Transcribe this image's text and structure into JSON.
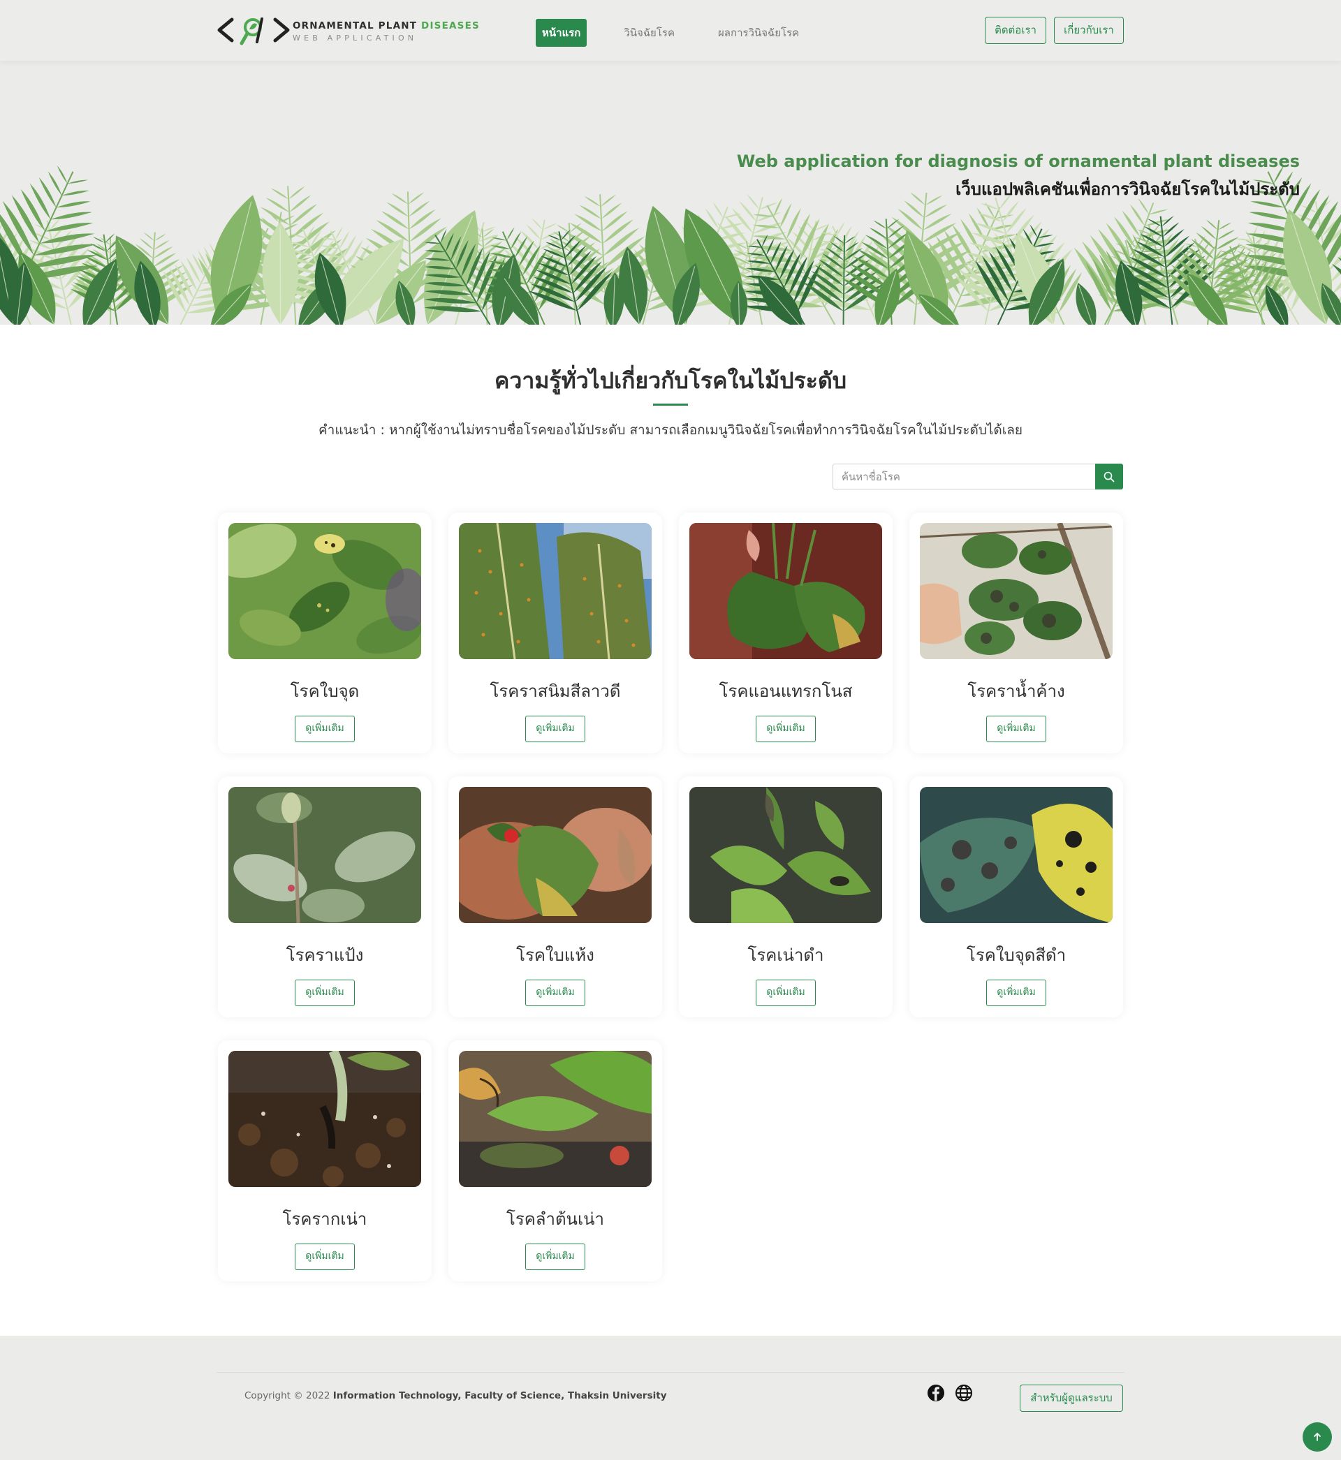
{
  "brand": {
    "title_main": "ORNAMENTAL PLANT",
    "title_accent": "DISEASES",
    "subtitle": "WEB APPLICATION",
    "accent_color": "#4ea84f"
  },
  "nav": {
    "items": [
      {
        "label": "หน้าแรก",
        "active": true
      },
      {
        "label": "วินิจฉัยโรค",
        "active": false
      },
      {
        "label": "ผลการวินิจฉัยโรค",
        "active": false
      }
    ],
    "contact_label": "ติดต่อเรา",
    "about_label": "เกี่ยวกับเรา"
  },
  "hero": {
    "title_en": "Web application for diagnosis of ornamental plant diseases",
    "title_th": "เว็บแอปพลิเคชันเพื่อการวินิจฉัยโรคในไม้ประดับ"
  },
  "section": {
    "title": "ความรู้ทั่วไปเกี่ยวกับโรคในไม้ประดับ",
    "description": "คำแนะนำ : หากผู้ใช้งานไม่ทราบชื่อโรคของไม้ประดับ สามารถเลือกเมนูวินิจฉัยโรคเพื่อทำการวินิจฉัยโรคในไม้ประดับได้เลย"
  },
  "search": {
    "placeholder": "ค้นหาชื่อโรค",
    "icon": "search-icon"
  },
  "diseases": [
    {
      "name": "โรคใบจุด",
      "button": "ดูเพิ่มเติม",
      "image": "leaf-spot-photo"
    },
    {
      "name": "โรคราสนิมสีลาวดี",
      "button": "ดูเพิ่มเติม",
      "image": "rust-frangipani-photo"
    },
    {
      "name": "โรคแอนแทรกโนส",
      "button": "ดูเพิ่มเติม",
      "image": "anthracnose-photo"
    },
    {
      "name": "โรคราน้ำค้าง",
      "button": "ดูเพิ่มเติม",
      "image": "downy-mildew-photo"
    },
    {
      "name": "โรคราแป้ง",
      "button": "ดูเพิ่มเติม",
      "image": "powdery-mildew-photo"
    },
    {
      "name": "โรคใบแห้ง",
      "button": "ดูเพิ่มเติม",
      "image": "leaf-blight-photo"
    },
    {
      "name": "โรคเน่าดำ",
      "button": "ดูเพิ่มเติม",
      "image": "black-rot-photo"
    },
    {
      "name": "โรคใบจุดสีดำ",
      "button": "ดูเพิ่มเติม",
      "image": "black-spot-photo"
    },
    {
      "name": "โรครากเน่า",
      "button": "ดูเพิ่มเติม",
      "image": "root-rot-photo"
    },
    {
      "name": "โรคลำต้นเน่า",
      "button": "ดูเพิ่มเติม",
      "image": "stem-rot-photo"
    }
  ],
  "footer": {
    "copyright_prefix": "Copyright © 2022",
    "copyright_org": "Information Technology, Faculty of Science, Thaksin University",
    "admin_label": "สำหรับผู้ดูแลระบบ",
    "social": [
      "facebook-icon",
      "globe-icon"
    ]
  },
  "colors": {
    "primary": "#2a8a4e",
    "hero_title": "#4a8c4e",
    "background": "#ebebea"
  }
}
